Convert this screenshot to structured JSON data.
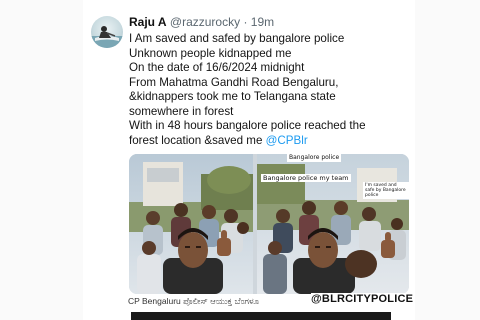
{
  "tweet": {
    "display_name": "Raju A",
    "handle": "@razzurocky",
    "separator": "·",
    "timestamp": "19m",
    "avatar_icon": "profile-avatar",
    "lines": [
      "I Am saved and safed by bangalore police",
      "Unknown people kidnapped me",
      "On the date of 16/6/2024 midnight",
      "From Mahatma Gandhi Road Bengaluru,",
      "&kidnappers took me to Telangana state",
      "somewhere in forest",
      "With in 48 hours bangalore police reached the",
      "forest location &saved me"
    ],
    "mention": "@CPBlr",
    "mention_color": "#1d9bf0"
  },
  "media": {
    "overlay_top": "Bangalore police",
    "overlay_team": "Bangalore police my team",
    "overlay_small": "I'm saved and safe by Bangalore police"
  },
  "caption": {
    "kannada": "CP Bengaluru ಪೊಲೀಸ್ ಆಯುಕ್ತ ಬೆಂಗಳೂ",
    "watermark": "@BLRCITYPOLICE"
  }
}
